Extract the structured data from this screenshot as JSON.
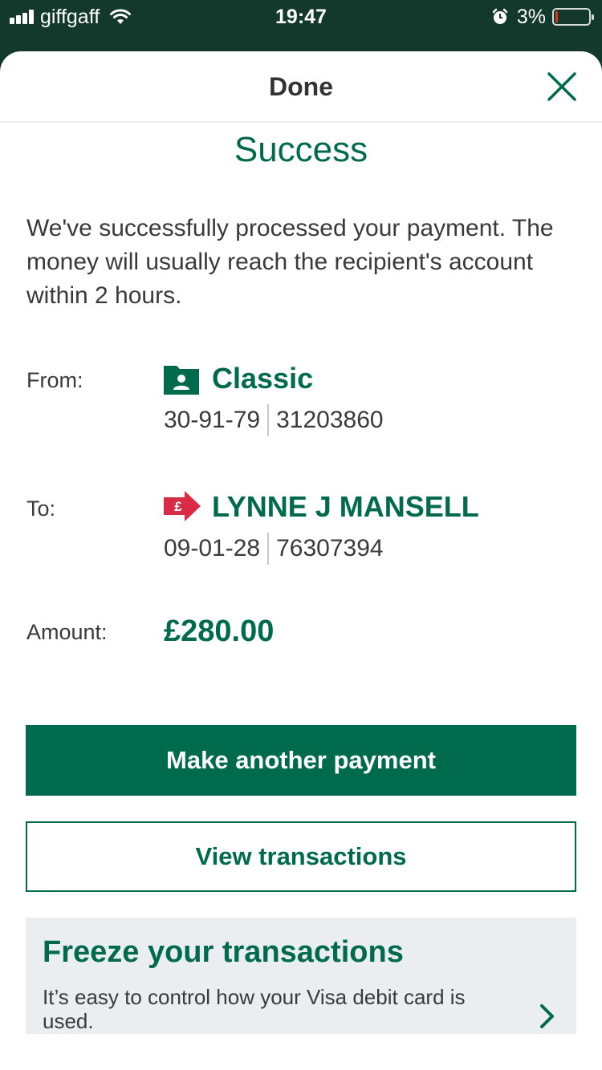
{
  "status_bar": {
    "carrier": "giffgaff",
    "time": "19:47",
    "battery": "3%",
    "icons": [
      "signal-icon",
      "wifi-icon",
      "alarm-icon",
      "battery-icon"
    ]
  },
  "nav": {
    "title": "Done",
    "close_icon": "close-icon"
  },
  "success": {
    "title": "Success",
    "message": "We've successfully processed your payment. The money will usually reach the recipient's account within 2 hours."
  },
  "from": {
    "label": "From:",
    "name": "Classic",
    "sort_code": "30-91-79",
    "account_number": "31203860",
    "icon": "account-folder-icon"
  },
  "to": {
    "label": "To:",
    "name": "LYNNE J MANSELL",
    "sort_code": "09-01-28",
    "account_number": "76307394",
    "icon": "payee-arrow-icon",
    "icon_glyph": "£"
  },
  "amount": {
    "label": "Amount:",
    "value": "£280.00"
  },
  "actions": {
    "primary_label": "Make another payment",
    "secondary_label": "View transactions"
  },
  "promo": {
    "title": "Freeze your transactions",
    "text": "It’s easy to control how your Visa debit card is used.",
    "chevron_icon": "chevron-right-icon"
  },
  "colors": {
    "brand_green": "#006a4d",
    "status_bar_bg": "#13382c",
    "payee_red": "#d92b45",
    "promo_bg": "#eaeef1",
    "battery_low": "#e0321e"
  }
}
